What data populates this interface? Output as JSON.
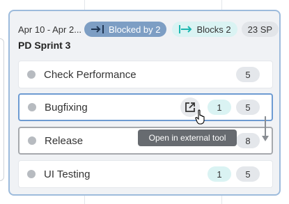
{
  "sprint": {
    "dates": "Apr 10 - Apr 2...",
    "blocked_by": "Blocked by 2",
    "blocks": "Blocks 2",
    "story_points": "23 SP",
    "title": "PD Sprint 3"
  },
  "items": [
    {
      "label": "Check Performance",
      "teal_badge": "",
      "points": "5"
    },
    {
      "label": "Bugfixing",
      "teal_badge": "1",
      "points": "5"
    },
    {
      "label": "Release",
      "teal_badge": "",
      "points": "8"
    },
    {
      "label": "UI Testing",
      "teal_badge": "1",
      "points": "5"
    }
  ],
  "tooltip": "Open in external tool",
  "colors": {
    "card_border": "#9dbbdc",
    "blocked_chip": "#7d9ec4",
    "blocks_chip": "#daf3f3",
    "hover_border": "#6d9bd2",
    "tooltip_bg": "#676b70"
  },
  "icons": [
    "blocked-by-icon",
    "blocks-icon",
    "status-dot-icon",
    "external-link-icon",
    "hand-cursor-icon",
    "drag-arrow-icon"
  ]
}
